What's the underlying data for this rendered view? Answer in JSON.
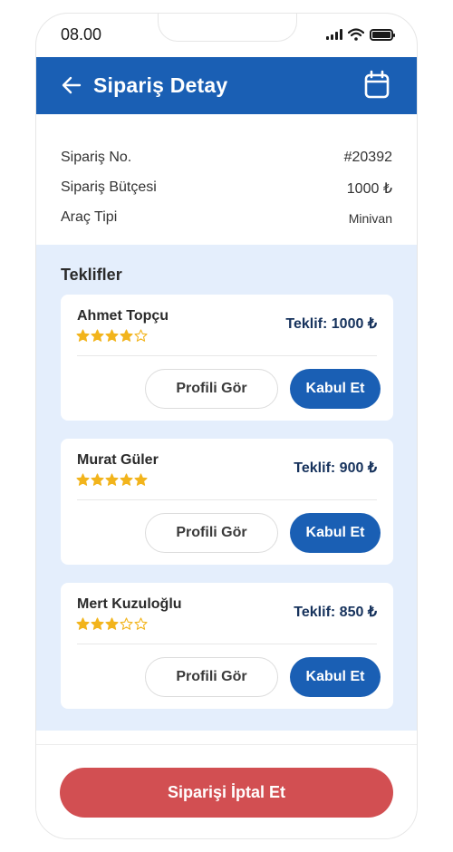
{
  "status_bar": {
    "time": "08.00"
  },
  "header": {
    "title": "Sipariş Detay",
    "back_icon": "arrow-left-icon",
    "calendar_icon": "calendar-icon"
  },
  "summary": [
    {
      "label": "Sipariş No.",
      "value": "#20392"
    },
    {
      "label": "Sipariş Bütçesi",
      "value": "1000 ₺"
    },
    {
      "label": "Araç Tipi",
      "value": "Minivan"
    }
  ],
  "offers": {
    "title": "Teklifler",
    "items": [
      {
        "name": "Ahmet Topçu",
        "rating": 4,
        "max_rating": 5,
        "price": "Teklif: 1000 ₺",
        "profile_label": "Profili Gör",
        "accept_label": "Kabul Et"
      },
      {
        "name": "Murat Güler",
        "rating": 5,
        "max_rating": 5,
        "price": "Teklif: 900 ₺",
        "profile_label": "Profili Gör",
        "accept_label": "Kabul Et"
      },
      {
        "name": "Mert Kuzuloğlu",
        "rating": 3,
        "max_rating": 5,
        "price": "Teklif: 850 ₺",
        "profile_label": "Profili Gör",
        "accept_label": "Kabul Et"
      }
    ]
  },
  "footer": {
    "cancel_label": "Siparişi İptal Et"
  },
  "colors": {
    "primary": "#1a5fb4",
    "danger": "#d24f52",
    "star": "#f2b41c",
    "offers_bg": "#e4eefc"
  }
}
